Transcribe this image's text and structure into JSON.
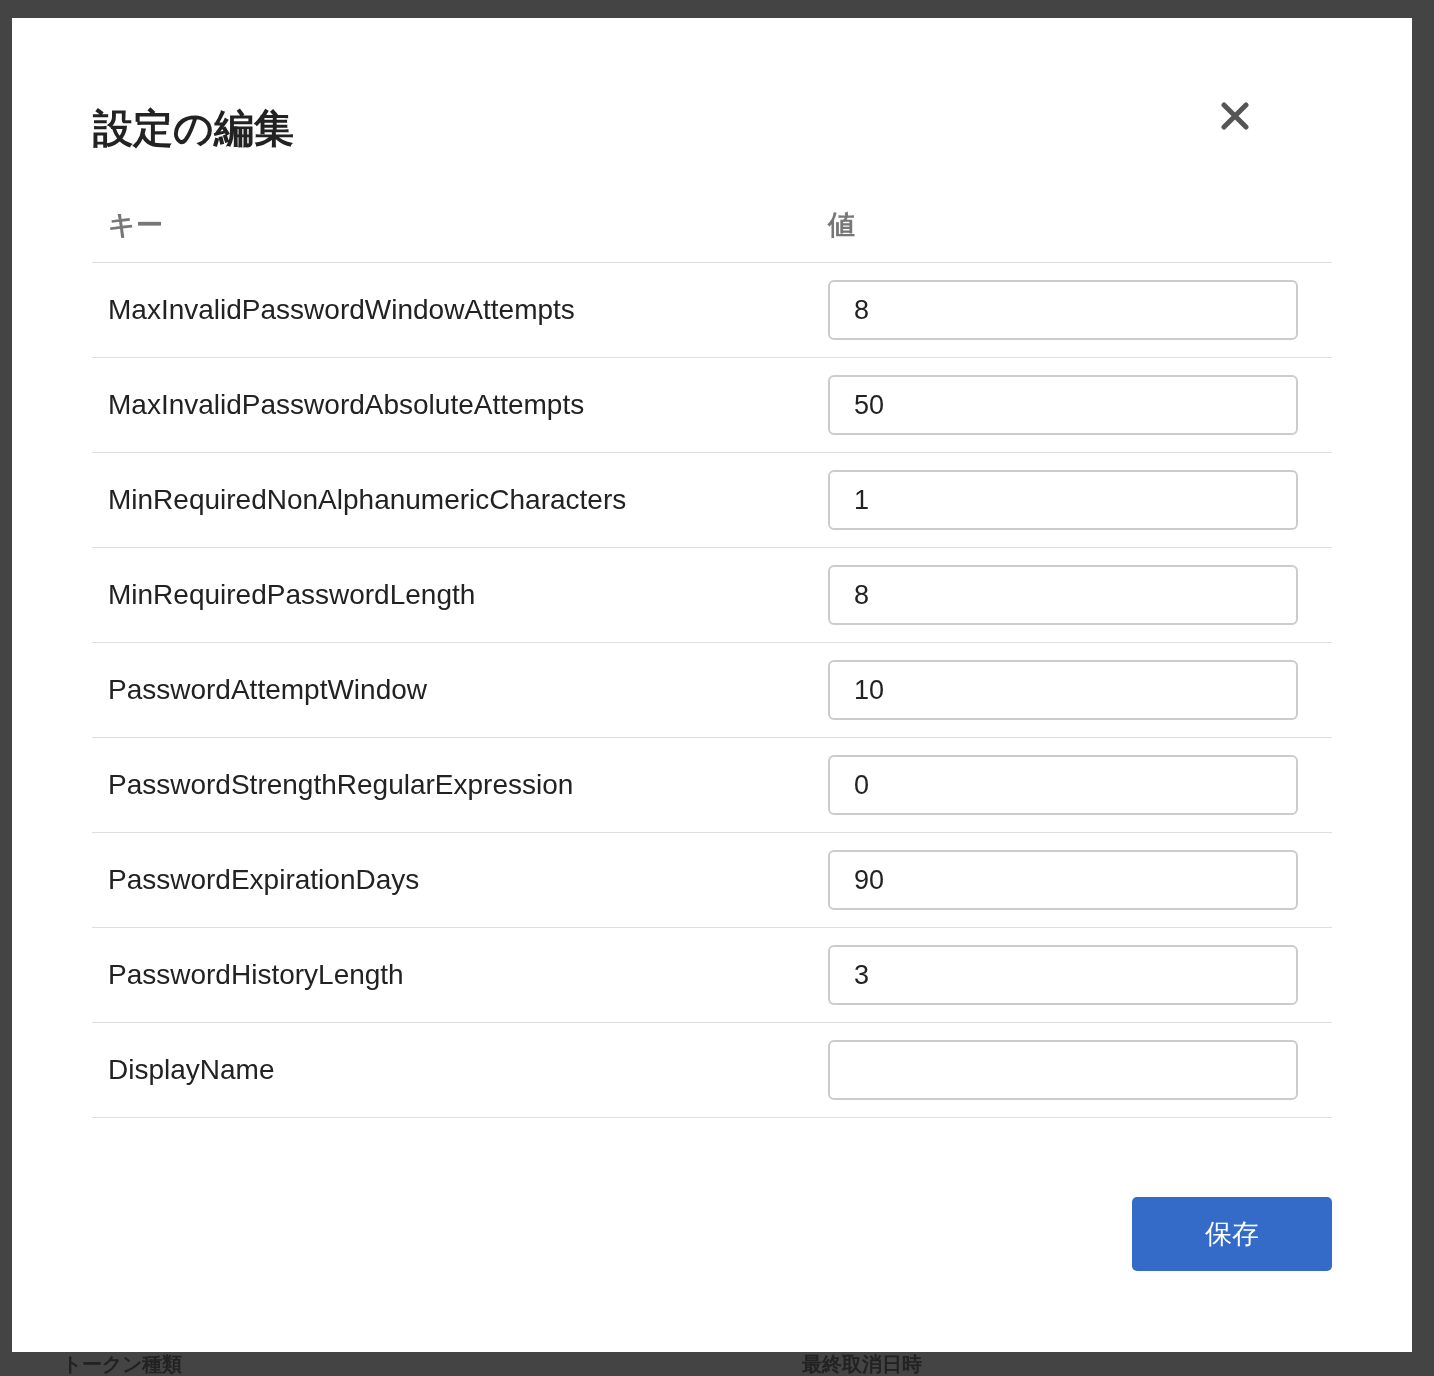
{
  "background": {
    "column_headers": [
      "トークン種類",
      "最終取消日時"
    ]
  },
  "dialog": {
    "title": "設定の編集",
    "columns": [
      "キー",
      "値"
    ],
    "rows": [
      {
        "key": "MaxInvalidPasswordWindowAttempts",
        "value": "8"
      },
      {
        "key": "MaxInvalidPasswordAbsoluteAttempts",
        "value": "50"
      },
      {
        "key": "MinRequiredNonAlphanumericCharacters",
        "value": "1"
      },
      {
        "key": "MinRequiredPasswordLength",
        "value": "8"
      },
      {
        "key": "PasswordAttemptWindow",
        "value": "10"
      },
      {
        "key": "PasswordStrengthRegularExpression",
        "value": "0"
      },
      {
        "key": "PasswordExpirationDays",
        "value": "90"
      },
      {
        "key": "PasswordHistoryLength",
        "value": "3"
      },
      {
        "key": "DisplayName"
      }
    ],
    "save_button": "保存"
  }
}
